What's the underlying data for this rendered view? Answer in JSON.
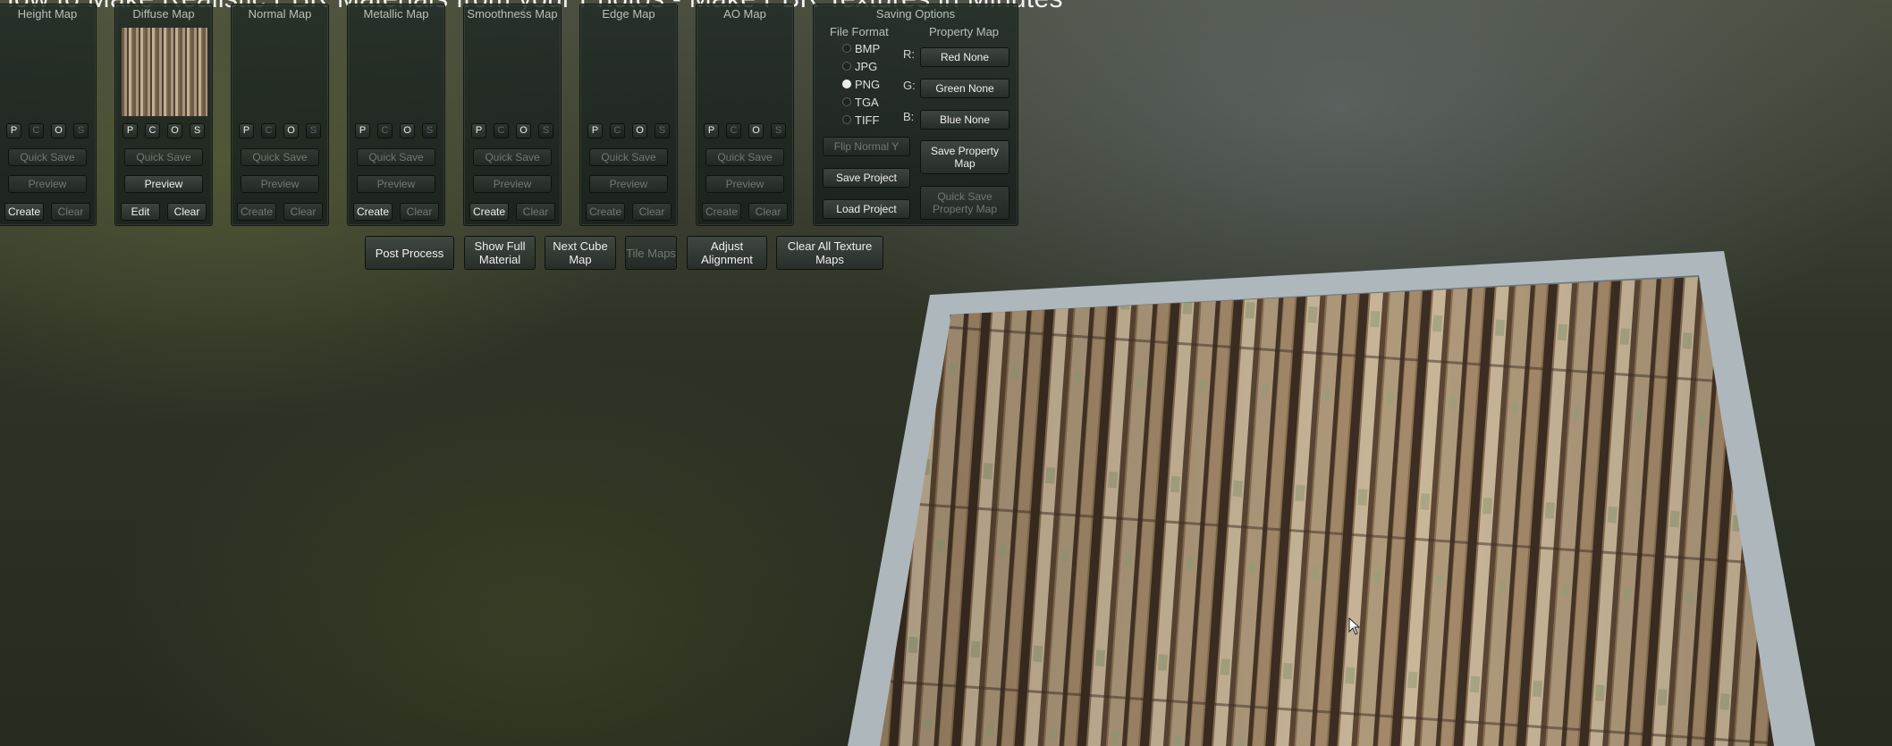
{
  "video_title": "How to Make Realistic PBR Materials from your Photos - Make PBR Textures in Minutes",
  "psos_letters": [
    "P",
    "C",
    "O",
    "S"
  ],
  "map_panels": [
    {
      "title": "Height Map",
      "has_thumbnail": false,
      "psos_active": [
        true,
        false,
        true,
        false
      ],
      "quick_save": "Quick Save",
      "quick_save_active": false,
      "preview": "Preview",
      "preview_active": false,
      "left_btn": "Create",
      "left_active": true,
      "right_btn": "Clear",
      "right_active": false
    },
    {
      "title": "Diffuse Map",
      "has_thumbnail": true,
      "psos_active": [
        true,
        true,
        true,
        true
      ],
      "quick_save": "Quick Save",
      "quick_save_active": false,
      "preview": "Preview",
      "preview_active": true,
      "left_btn": "Edit",
      "left_active": true,
      "right_btn": "Clear",
      "right_active": true
    },
    {
      "title": "Normal Map",
      "has_thumbnail": false,
      "psos_active": [
        true,
        false,
        true,
        false
      ],
      "quick_save": "Quick Save",
      "quick_save_active": false,
      "preview": "Preview",
      "preview_active": false,
      "left_btn": "Create",
      "left_active": false,
      "right_btn": "Clear",
      "right_active": false
    },
    {
      "title": "Metallic Map",
      "has_thumbnail": false,
      "psos_active": [
        true,
        false,
        true,
        false
      ],
      "quick_save": "Quick Save",
      "quick_save_active": false,
      "preview": "Preview",
      "preview_active": false,
      "left_btn": "Create",
      "left_active": true,
      "right_btn": "Clear",
      "right_active": false
    },
    {
      "title": "Smoothness Map",
      "has_thumbnail": false,
      "psos_active": [
        true,
        false,
        true,
        false
      ],
      "quick_save": "Quick Save",
      "quick_save_active": false,
      "preview": "Preview",
      "preview_active": false,
      "left_btn": "Create",
      "left_active": true,
      "right_btn": "Clear",
      "right_active": false
    },
    {
      "title": "Edge Map",
      "has_thumbnail": false,
      "psos_active": [
        true,
        false,
        true,
        false
      ],
      "quick_save": "Quick Save",
      "quick_save_active": false,
      "preview": "Preview",
      "preview_active": false,
      "left_btn": "Create",
      "left_active": false,
      "right_btn": "Clear",
      "right_active": false
    },
    {
      "title": "AO Map",
      "has_thumbnail": false,
      "psos_active": [
        true,
        false,
        true,
        false
      ],
      "quick_save": "Quick Save",
      "quick_save_active": false,
      "preview": "Preview",
      "preview_active": false,
      "left_btn": "Create",
      "left_active": false,
      "right_btn": "Clear",
      "right_active": false
    }
  ],
  "saving": {
    "title": "Saving Options",
    "file_format_label": "File Format",
    "formats": [
      {
        "label": "BMP",
        "selected": false
      },
      {
        "label": "JPG",
        "selected": false
      },
      {
        "label": "PNG",
        "selected": true
      },
      {
        "label": "TGA",
        "selected": false
      },
      {
        "label": "TIFF",
        "selected": false
      }
    ],
    "property_map_label": "Property Map",
    "channels": [
      {
        "letter": "R:",
        "button": "Red None"
      },
      {
        "letter": "G:",
        "button": "Green None"
      },
      {
        "letter": "B:",
        "button": "Blue None"
      }
    ],
    "flip_normal": "Flip Normal Y",
    "save_property_map": "Save Property Map",
    "save_project": "Save Project",
    "quick_save_property_map": "Quick Save Property Map",
    "load_project": "Load Project"
  },
  "actions": [
    {
      "label": "Post Process",
      "active": true
    },
    {
      "label": "Show Full Material",
      "active": true
    },
    {
      "label": "Next Cube Map",
      "active": true
    },
    {
      "label": "Tile Maps",
      "active": false
    },
    {
      "label": "Adjust Alignment",
      "active": true
    },
    {
      "label": "Clear All Texture Maps",
      "active": true
    }
  ],
  "colors": {
    "frame": "#aeb7bb",
    "bark_base": "#8a6f52",
    "bark_light": "#c9b699",
    "bark_dark": "#3c2e22",
    "lichen": "#9aa07a"
  }
}
